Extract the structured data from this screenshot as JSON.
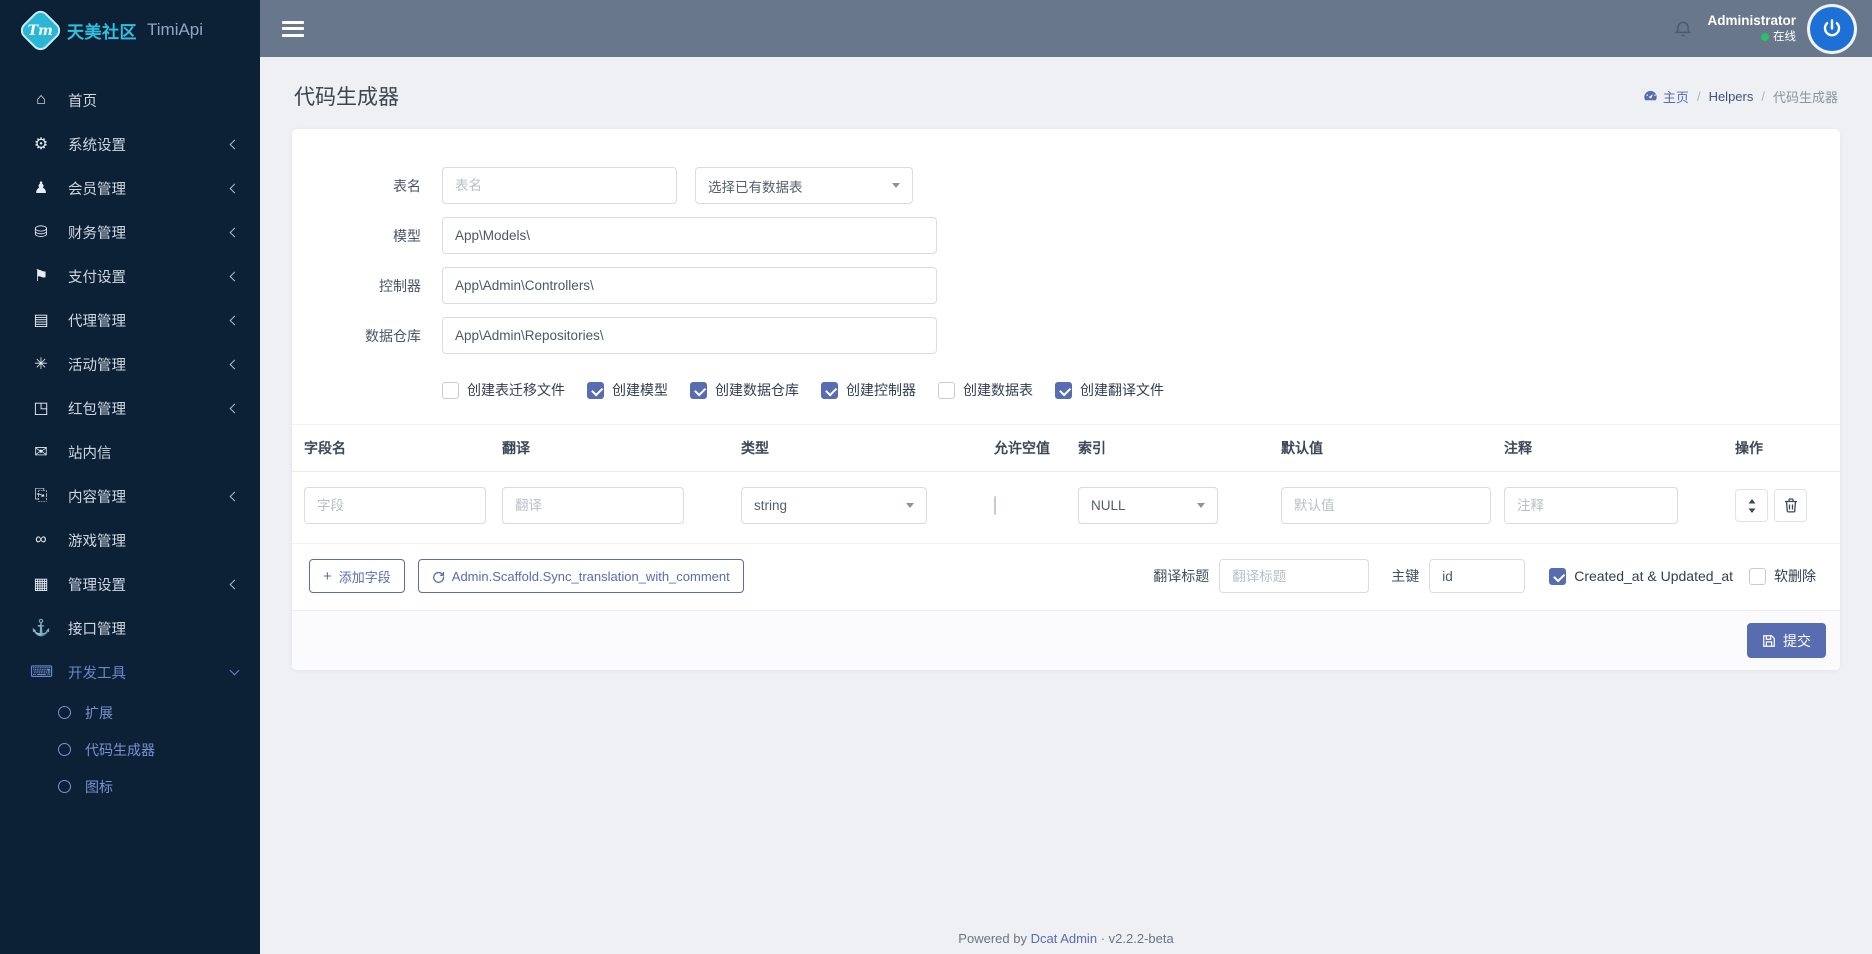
{
  "brand": {
    "badge": "Tm",
    "name": "天美社区",
    "subtitle": "TimiApi"
  },
  "topbar": {
    "username": "Administrator",
    "status_text": "在线"
  },
  "sidebar": {
    "items": [
      {
        "label": "首页",
        "icon": "home-icon",
        "glyph": "⌂"
      },
      {
        "label": "系统设置",
        "icon": "gears-icon",
        "glyph": "⚙"
      },
      {
        "label": "会员管理",
        "icon": "user-icon",
        "glyph": "♟"
      },
      {
        "label": "财务管理",
        "icon": "database-icon",
        "glyph": "⛁"
      },
      {
        "label": "支付设置",
        "icon": "bookmark-icon",
        "glyph": "⚑"
      },
      {
        "label": "代理管理",
        "icon": "address-book-icon",
        "glyph": "▤"
      },
      {
        "label": "活动管理",
        "icon": "asterisk-icon",
        "glyph": "✳"
      },
      {
        "label": "红包管理",
        "icon": "cubes-icon",
        "glyph": "◳"
      },
      {
        "label": "站内信",
        "icon": "envelope-icon",
        "glyph": "✉"
      },
      {
        "label": "内容管理",
        "icon": "copy-icon",
        "glyph": "⎘"
      },
      {
        "label": "游戏管理",
        "icon": "gamepad-icon",
        "glyph": "∞"
      },
      {
        "label": "管理设置",
        "icon": "id-card-icon",
        "glyph": "▦"
      },
      {
        "label": "接口管理",
        "icon": "anchor-icon",
        "glyph": "⚓"
      },
      {
        "label": "开发工具",
        "icon": "keyboard-icon",
        "glyph": "⌨",
        "children": [
          {
            "label": "扩展"
          },
          {
            "label": "代码生成器"
          },
          {
            "label": "图标"
          }
        ]
      }
    ]
  },
  "header": {
    "title": "代码生成器",
    "breadcrumb": {
      "home": "主页",
      "middle": "Helpers",
      "current": "代码生成器"
    }
  },
  "form": {
    "table_name": {
      "label": "表名",
      "placeholder": "表名",
      "select_placeholder": "选择已有数据表"
    },
    "model": {
      "label": "模型",
      "value": "App\\Models\\"
    },
    "controller": {
      "label": "控制器",
      "value": "App\\Admin\\Controllers\\"
    },
    "repository": {
      "label": "数据仓库",
      "value": "App\\Admin\\Repositories\\"
    },
    "options": [
      {
        "label": "创建表迁移文件",
        "checked": false
      },
      {
        "label": "创建模型",
        "checked": true
      },
      {
        "label": "创建数据仓库",
        "checked": true
      },
      {
        "label": "创建控制器",
        "checked": true
      },
      {
        "label": "创建数据表",
        "checked": false
      },
      {
        "label": "创建翻译文件",
        "checked": true
      }
    ]
  },
  "fields_table": {
    "headers": [
      "字段名",
      "翻译",
      "类型",
      "允许空值",
      "索引",
      "默认值",
      "注释",
      "操作"
    ],
    "row": {
      "field_placeholder": "字段",
      "translation_placeholder": "翻译",
      "type_value": "string",
      "nullable_checked": false,
      "index_value": "NULL",
      "default_placeholder": "默认值",
      "comment_placeholder": "注释"
    }
  },
  "toolbar": {
    "add_field_label": "添加字段",
    "sync_label": "Admin.Scaffold.Sync_translation_with_comment",
    "translation_title": {
      "label": "翻译标题",
      "placeholder": "翻译标题"
    },
    "primary_key": {
      "label": "主键",
      "value": "id"
    },
    "timestamps": {
      "label": "Created_at & Updated_at",
      "checked": true
    },
    "soft_delete": {
      "label": "软删除",
      "checked": false
    },
    "submit_label": "提交"
  },
  "footer": {
    "powered_by": "Powered by",
    "brand_link": "Dcat Admin",
    "separator": "·",
    "version": "v2.2.2-beta"
  },
  "colors": {
    "primary": "#586cb1",
    "sidebar_bg": "#0d2136",
    "topbar_bg": "#69778c",
    "brand_teal": "#2bb5d6",
    "online_green": "#26c167",
    "avatar_blue": "#1d71d6"
  }
}
